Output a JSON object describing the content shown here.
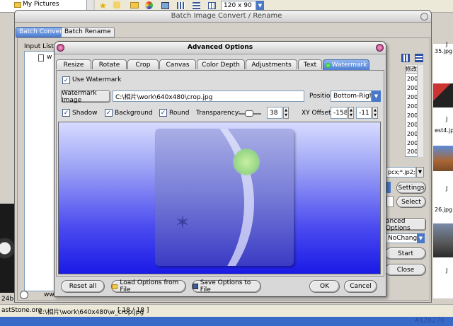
{
  "desktop": {
    "explorer_item": "My Pictures",
    "size_combo": "120 x 90",
    "status_site": "astStone.org",
    "status_path": "C:\\相片\\work\\640x480\\w_crop.jpg",
    "status_count": "[ 18 / 18 ]",
    "watermark_id": "#128276",
    "left_partial": "24b",
    "thumb_labels": [
      "J",
      "J",
      "J",
      "J"
    ],
    "thumb_files": [
      "35.jpg",
      "est4.jpg",
      "26.jpg"
    ],
    "accent": "#2b4fa3"
  },
  "batch_window": {
    "title": "Batch Image Convert / Rename",
    "tabs": [
      "Batch Convert",
      "Batch Rename"
    ],
    "input_list_label": "Input List:",
    "input_item": "w",
    "right_column": {
      "header": "修改",
      "values": [
        "200",
        "200",
        "200",
        "200",
        "200",
        "200",
        "200",
        "200",
        "200"
      ],
      "filter": "pcx;*.jp2;*.j"
    },
    "settings_button": "Settings",
    "select_button": "Select",
    "advanced_button": "anced Options",
    "nochange_value": "NoChange",
    "start_button": "Start",
    "close_button": "Close",
    "bottom_partial": "ww"
  },
  "advanced_dialog": {
    "title": "Advanced Options",
    "tabs": [
      "Resize",
      "Rotate",
      "Crop",
      "Canvas",
      "Color Depth",
      "Adjustments",
      "Text",
      "Watermark"
    ],
    "active_tab": "Watermark",
    "use_watermark": {
      "label": "Use Watermark",
      "checked": true
    },
    "watermark_image_button": "Watermark Image",
    "watermark_path": "C:\\相片\\work\\640x480\\crop.jpg",
    "position_label": "Position:",
    "position_value": "Bottom-Right",
    "shadow": {
      "label": "Shadow",
      "checked": true
    },
    "background": {
      "label": "Background",
      "checked": true
    },
    "round": {
      "label": "Round",
      "checked": true
    },
    "transparency_label": "Transparency:",
    "transparency_value": "38",
    "xy_offset_label": "XY Offset:",
    "x_offset": "-158",
    "y_offset": "-11",
    "buttons": {
      "reset": "Reset all",
      "load": "Load Options from File",
      "save": "Save Options to File",
      "ok": "OK",
      "cancel": "Cancel"
    }
  }
}
